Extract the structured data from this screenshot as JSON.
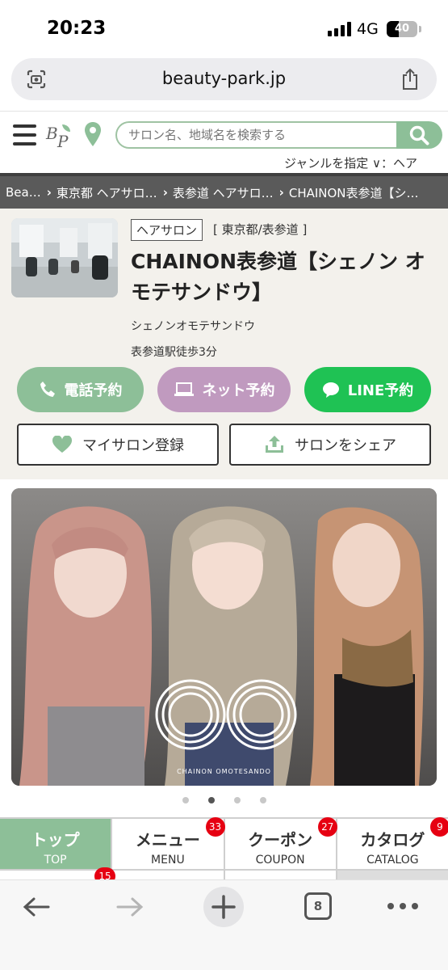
{
  "status_bar": {
    "time": "20:23",
    "network": "4G",
    "battery": "40",
    "battery_level": 0.4
  },
  "browser": {
    "url": "beauty-park.jp",
    "tab_count": "8"
  },
  "header": {
    "search_placeholder": "サロン名、地域名を検索する",
    "genre_label": "ジャンルを指定 ∨：ヘア"
  },
  "breadcrumb": [
    "Bea…",
    "東京都 ヘアサロ…",
    "表参道 ヘアサロ…",
    "CHAINON表参道【シ…"
  ],
  "salon": {
    "tag": "ヘアサロン",
    "area": "[ 東京都/表参道 ]",
    "name": "CHAINON表参道【シェノン オモテサンドウ】",
    "kana": "シェノンオモテサンドウ",
    "access": "表参道駅徒歩3分",
    "buttons": {
      "phone": "電話予約",
      "net": "ネット予約",
      "line": "LINE予約",
      "mysalon": "マイサロン登録",
      "share": "サロンをシェア"
    }
  },
  "hero": {
    "logo_text": "CE",
    "caption": "CHAINON OMOTESANDO"
  },
  "carousel": {
    "count": 4,
    "active_index": 1
  },
  "tabs": [
    {
      "jp": "トップ",
      "en": "TOP",
      "badge": ""
    },
    {
      "jp": "メニュー",
      "en": "MENU",
      "badge": "33"
    },
    {
      "jp": "クーポン",
      "en": "COUPON",
      "badge": "27"
    },
    {
      "jp": "カタログ",
      "en": "CATALOG",
      "badge": "9"
    }
  ],
  "tabs_row2_badge": "15",
  "colors": {
    "accent_green": "#8dbf98",
    "net_purple": "#c09abf",
    "line_green": "#1fc254",
    "badge_red": "#e60012"
  }
}
